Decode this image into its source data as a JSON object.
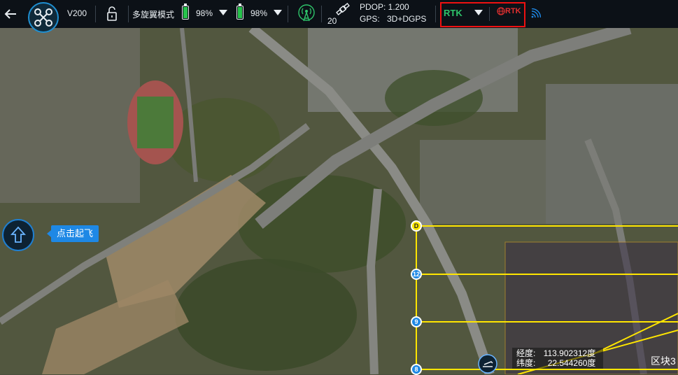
{
  "topbar": {
    "back_icon": "arrow-left-icon",
    "drone_model": "V200",
    "lock_icon": "lock-open-icon",
    "flight_mode": "多旋翼模式",
    "battery1_percent": "98%",
    "battery2_percent": "98%",
    "satellite_count": "20",
    "pdop": "PDOP: 1.200",
    "gps_label": "GPS:",
    "gps_mode": "3D+DGPS",
    "rtk_label": "RTK",
    "rtk_network_label": "RTK",
    "colors": {
      "bar_bg": "#0c1117",
      "rtk_green": "#2ec46a",
      "rtk_red": "#e23030",
      "battery_green": "#27c24c",
      "accent_blue": "#1e88e5"
    }
  },
  "map": {
    "takeoff_tooltip": "点击起飞",
    "waypoint_start_label": "D",
    "waypoint_labels": [
      "12",
      "9",
      "8"
    ],
    "longitude_label": "经度:",
    "longitude_value": "113.902312度",
    "latitude_label": "纬度:",
    "latitude_value": "22.544260度",
    "area_label": "区块3",
    "route_color": "#ffe600"
  }
}
